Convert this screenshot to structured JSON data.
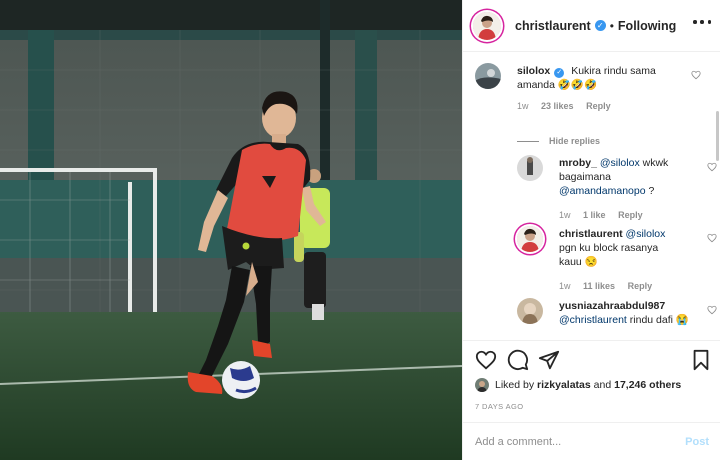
{
  "header": {
    "username": "christlaurent",
    "separator": "•",
    "follow_state": "Following",
    "verified_glyph": "✓",
    "more_icon": "more-horizontal-icon"
  },
  "comments": [
    {
      "username": "silolox",
      "verified": true,
      "text": "Kukira rindu sama amanda 🤣🤣🤣",
      "time": "1w",
      "likes": "23 likes",
      "reply_label": "Reply",
      "hide_replies": "Hide replies"
    },
    {
      "username": "mroby_",
      "mention1": "@silolox",
      "text": "wkwk bagaimana",
      "mention2": "@amandamanopo",
      "text_end": "?",
      "time": "1w",
      "likes": "1 like",
      "reply_label": "Reply"
    },
    {
      "username": "christlaurent",
      "mention1": "@silolox",
      "text": "pgn ku block rasanya kauu 😒",
      "time": "1w",
      "likes": "11 likes",
      "reply_label": "Reply"
    },
    {
      "username": "yusniazahraabdul987",
      "mention1": "@christlaurent",
      "text": "rindu dafi",
      "emoji": "😭"
    }
  ],
  "liked_by": {
    "prefix": "Liked by",
    "user": "rizkyalatas",
    "mid": "and",
    "others": "17,246 others"
  },
  "time_ago": "7 DAYS AGO",
  "composer": {
    "placeholder": "Add a comment...",
    "post_label": "Post"
  },
  "colors": {
    "accent_link": "#00376b",
    "verified": "#3897f0",
    "post_disabled": "#b2dffc",
    "muted": "#8e8e8e"
  }
}
